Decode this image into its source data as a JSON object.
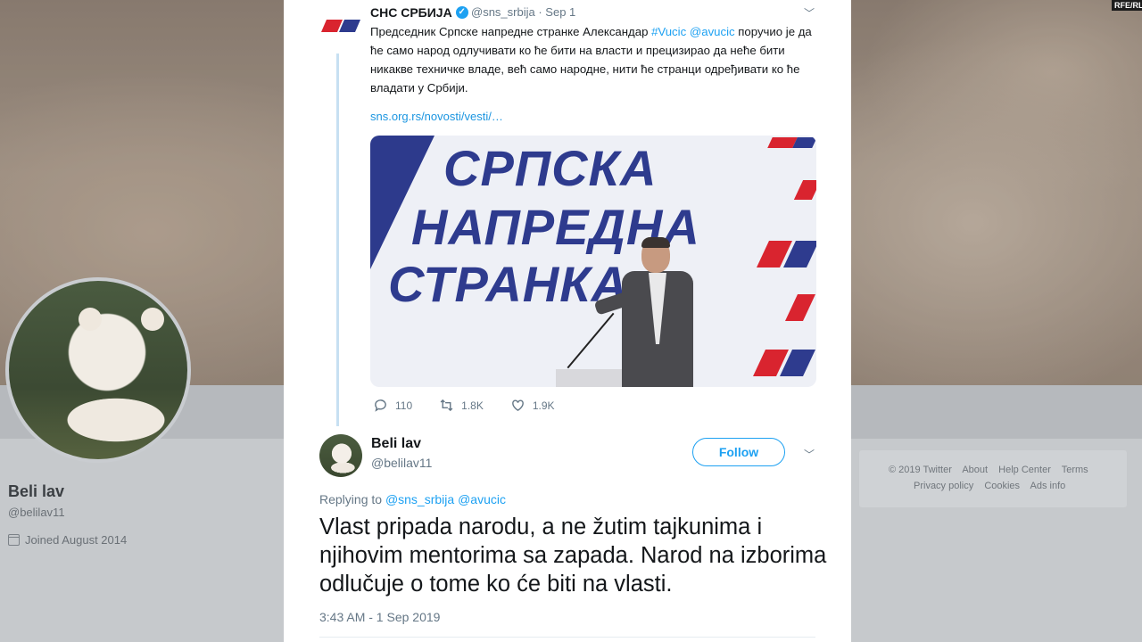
{
  "watermark": "RFE/RL",
  "background_profile": {
    "name": "Beli lav",
    "handle": "@belilav11",
    "joined": "Joined August 2014",
    "footer_links_row1": [
      "© 2019 Twitter",
      "About",
      "Help Center",
      "Terms"
    ],
    "footer_links_row2": [
      "Privacy policy",
      "Cookies",
      "Ads info"
    ]
  },
  "quoted_tweet": {
    "author_name": "СНС СРБИЈА",
    "handle": "@sns_srbija",
    "date": "· Sep 1",
    "text_before_tags": "Председник Српске напредне странке Александар ",
    "tag1": "#Vucic",
    "tag2": "@avucic",
    "text_after_tags": " поручио је да ће само народ одлучивати ко ће бити на власти и прецизирао да неће бити никакве техничке владе, већ само народне, нити ће странци одређивати ко ће владати у Србији.",
    "link": "sns.org.rs/novosti/vesti/…",
    "image_lines": [
      "СРПСКА",
      "НАПРЕДНА",
      "СТРАНКА"
    ],
    "replies": "110",
    "retweets": "1.8K",
    "likes": "1.9K"
  },
  "reply_tweet": {
    "author_name": "Beli lav",
    "handle": "@belilav11",
    "follow_label": "Follow",
    "replying_prefix": "Replying to",
    "replying_mentions": "@sns_srbija @avucic",
    "text": "Vlast pripada narodu, a ne žutim tajkunima i njihovim mentorima sa zapada. Narod na izborima odlučuje o tome ko će biti na vlasti.",
    "timestamp": "3:43 AM - 1 Sep 2019"
  },
  "colors": {
    "twitter_blue": "#1da1f2",
    "sns_blue": "#2e3b8e",
    "sns_red": "#d9242f"
  }
}
